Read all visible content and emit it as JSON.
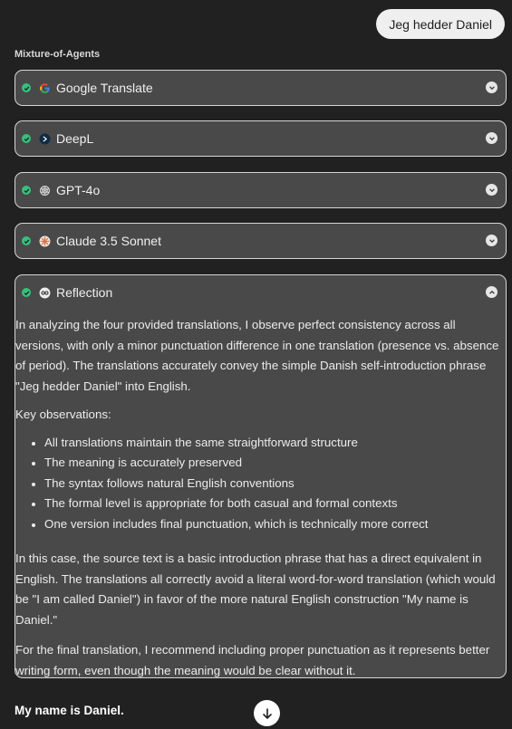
{
  "user_message": "Jeg hedder Daniel",
  "section_label": "Mixture-of-Agents",
  "agents": [
    {
      "name": "Google Translate",
      "logo": "google-logo-icon",
      "status": "done",
      "expanded": false
    },
    {
      "name": "DeepL",
      "logo": "deepl-logo-icon",
      "status": "done",
      "expanded": false
    },
    {
      "name": "GPT-4o",
      "logo": "openai-logo-icon",
      "status": "done",
      "expanded": false
    },
    {
      "name": "Claude 3.5 Sonnet",
      "logo": "claude-logo-icon",
      "status": "done",
      "expanded": false
    }
  ],
  "reflection": {
    "name": "Reflection",
    "logo": "reflection-logo-icon",
    "status": "done",
    "expanded": true,
    "paragraph1": "In analyzing the four provided translations, I observe perfect consistency across all versions, with only a minor punctuation difference in one translation (presence vs. absence of period). The translations accurately convey the simple Danish self-introduction phrase \"Jeg hedder Daniel\" into English.",
    "observations_heading": "Key observations:",
    "observations": [
      "All translations maintain the same straightforward structure",
      "The meaning is accurately preserved",
      "The syntax follows natural English conventions",
      "The formal level is appropriate for both casual and formal contexts",
      "One version includes final punctuation, which is technically more correct"
    ],
    "paragraph2": "In this case, the source text is a basic introduction phrase that has a direct equivalent in English. The translations all correctly avoid a literal word-for-word translation (which would be \"I am called Daniel\") in favor of the more natural English construction \"My name is Daniel.\"",
    "paragraph3": "For the final translation, I recommend including proper punctuation as it represents better writing form, even though the meaning would be clear without it."
  },
  "final_translation": "My name is Daniel.",
  "colors": {
    "background": "#212121",
    "card": "#494949",
    "card_border": "#d6d6d6",
    "check": "#35c07c",
    "user_bubble": "#efefef"
  }
}
